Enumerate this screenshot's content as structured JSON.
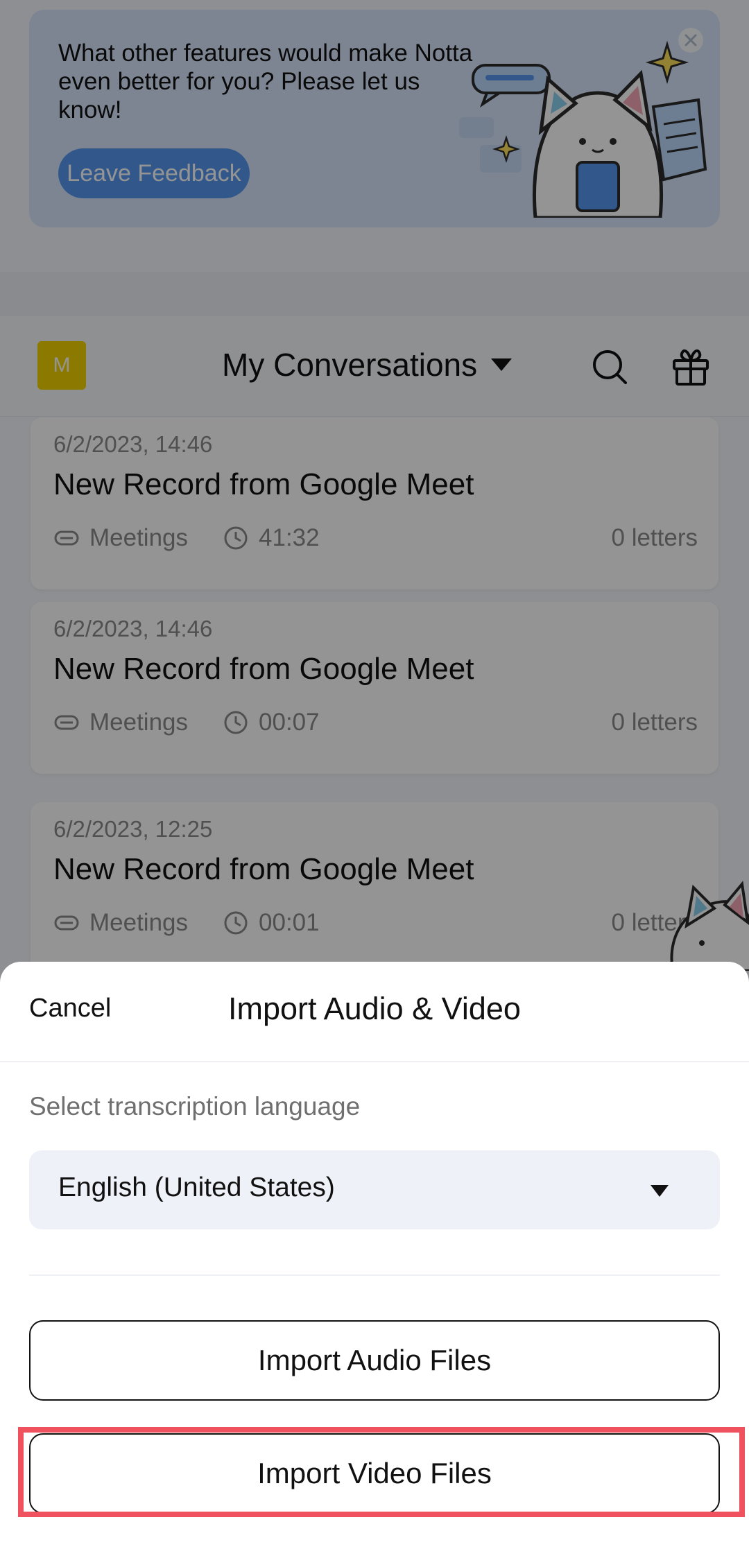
{
  "banner": {
    "text": "What other features would make Notta even better for you? Please let us know!",
    "button_label": "Leave Feedback"
  },
  "header": {
    "avatar_initial": "M",
    "title": "My Conversations"
  },
  "conversations": [
    {
      "date": "6/2/2023, 14:46",
      "title": "New Record from Google Meet",
      "category": "Meetings",
      "duration": "41:32",
      "letters": "0 letters"
    },
    {
      "date": "6/2/2023, 14:46",
      "title": "New Record from Google Meet",
      "category": "Meetings",
      "duration": "00:07",
      "letters": "0 letters"
    },
    {
      "date": "6/2/2023, 12:25",
      "title": "New Record from Google Meet",
      "category": "Meetings",
      "duration": "00:01",
      "letters": "0 letters"
    }
  ],
  "sheet": {
    "cancel_label": "Cancel",
    "title": "Import Audio & Video",
    "language_label": "Select transcription language",
    "language_value": "English (United States)",
    "import_audio_label": "Import Audio Files",
    "import_video_label": "Import Video Files"
  },
  "colors": {
    "avatar": "#f1d200",
    "banner_bg": "#d7e6fc",
    "banner_button": "#5797f0",
    "highlight": "#f0515e"
  },
  "icons": [
    "close-icon",
    "search-icon",
    "gift-icon",
    "meeting-icon",
    "clock-icon",
    "dropdown-caret-icon",
    "mascot-icon"
  ]
}
